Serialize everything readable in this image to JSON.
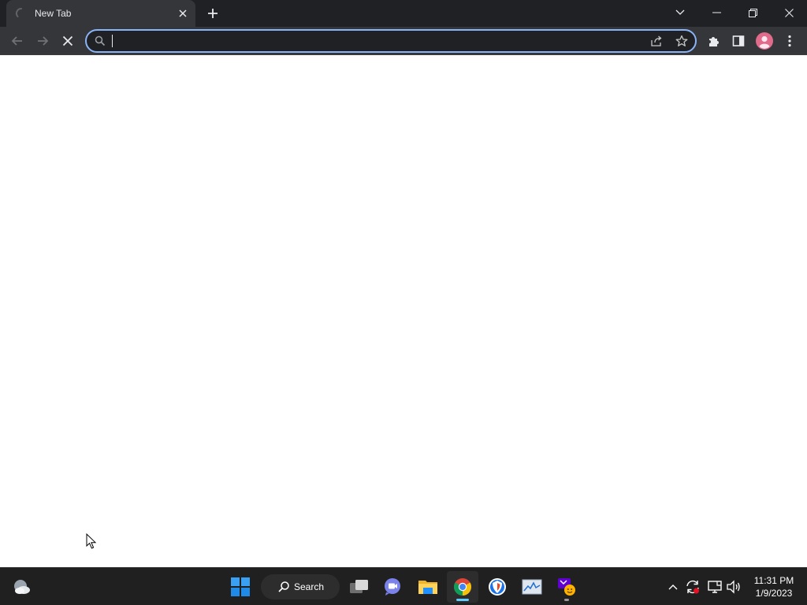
{
  "browser": {
    "tab": {
      "title": "New Tab"
    },
    "omnibox": {
      "value": "",
      "placeholder": ""
    }
  },
  "icons": {
    "tab_spinner": "loading-spinner-icon",
    "tab_close": "close-icon",
    "new_tab": "plus-icon",
    "tab_search": "chevron-down-icon",
    "minimize": "minimize-icon",
    "restore": "restore-icon",
    "close_window": "close-icon",
    "back": "arrow-left-icon",
    "forward": "arrow-right-icon",
    "stop": "x-icon",
    "omnibox_search": "search-icon",
    "share": "share-icon",
    "bookmark": "star-icon",
    "extensions": "puzzle-icon",
    "side_panel": "side-panel-icon",
    "profile": "avatar-icon",
    "menu": "kebab-menu-icon"
  },
  "taskbar": {
    "search_label": "Search",
    "apps": [
      "weather",
      "start",
      "task-view",
      "teams-chat",
      "file-explorer",
      "chrome",
      "brave",
      "performance-monitor",
      "yahoo-mail"
    ],
    "active_app": "chrome",
    "clock": {
      "time": "11:31 PM",
      "date": "1/9/2023"
    }
  },
  "colors": {
    "tabstrip": "#202124",
    "toolbar": "#35363a",
    "focus_ring": "#8ab4f8",
    "profile": "#e06b8b",
    "taskbar": "#202020",
    "active_indicator": "#60cdff"
  }
}
